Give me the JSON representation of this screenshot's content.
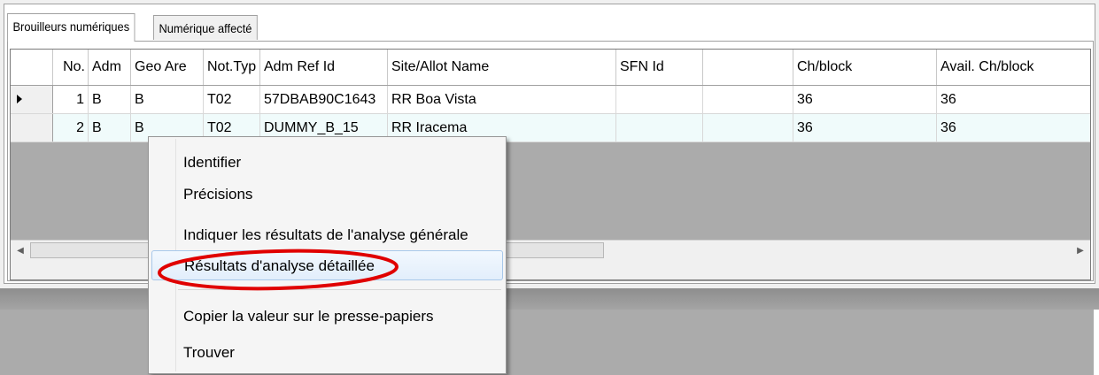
{
  "tabs": [
    {
      "label": "Brouilleurs numériques"
    },
    {
      "label": "Numérique affecté"
    }
  ],
  "grid": {
    "columns": [
      "",
      "No.",
      "Adm",
      "Geo Are",
      "Not.Typ",
      "Adm Ref Id",
      "Site/Allot Name",
      "SFN Id",
      "",
      "Ch/block",
      "Avail. Ch/block"
    ],
    "rows": [
      {
        "no": "1",
        "adm": "B",
        "geo": "B",
        "not_type": "T02",
        "adm_ref_id": "57DBAB90C1643",
        "site_name": "RR Boa Vista",
        "sfn_id": "",
        "blank": "",
        "ch_block": "36",
        "avail_ch_block": "36"
      },
      {
        "no": "2",
        "adm": "B",
        "geo": "B",
        "not_type": "T02",
        "adm_ref_id": "DUMMY_B_15",
        "site_name": "RR Iracema",
        "sfn_id": "",
        "blank": "",
        "ch_block": "36",
        "avail_ch_block": "36"
      }
    ]
  },
  "scrollbar": {
    "left_arrow": "◀",
    "right_arrow": "▶"
  },
  "context_menu": {
    "items": [
      {
        "label": "Identifier"
      },
      {
        "label": "Précisions"
      },
      {
        "label": "Indiquer les résultats de l'analyse générale"
      },
      {
        "label": "Résultats d'analyse détaillée"
      },
      {
        "label": "Copier la valeur sur le presse-papiers"
      },
      {
        "label": "Trouver"
      }
    ],
    "highlighted_index": 3
  },
  "colors": {
    "annotation": "#e00000",
    "highlight_border": "#a8c8ea"
  }
}
